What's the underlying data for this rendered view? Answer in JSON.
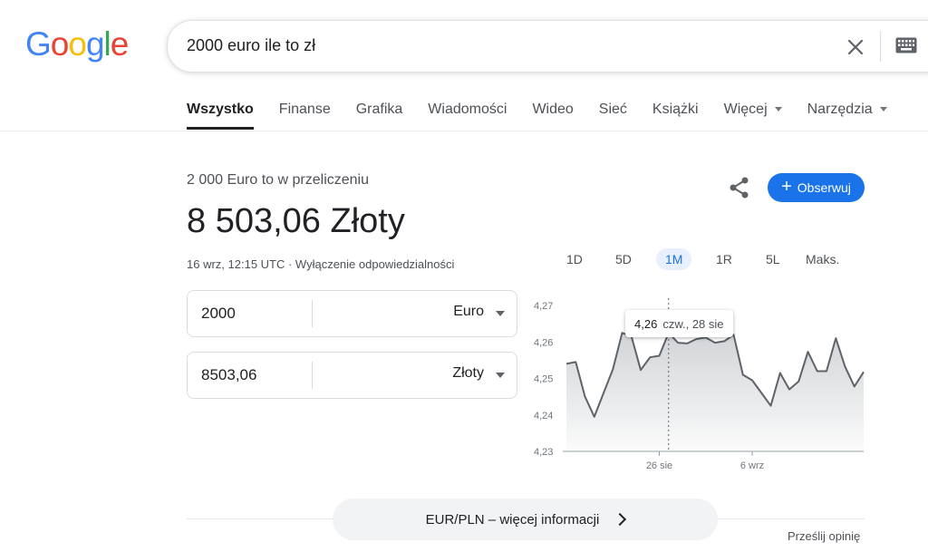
{
  "logo": {
    "letters": [
      "G",
      "o",
      "o",
      "g",
      "l",
      "e"
    ],
    "colors": [
      "#4285F4",
      "#EA4335",
      "#FBBC05",
      "#4285F4",
      "#34A853",
      "#EA4335"
    ]
  },
  "search": {
    "query": "2000 euro ile to zł"
  },
  "tabs": [
    {
      "label": "Wszystko",
      "active": true
    },
    {
      "label": "Finanse"
    },
    {
      "label": "Grafika"
    },
    {
      "label": "Wiadomości"
    },
    {
      "label": "Wideo"
    },
    {
      "label": "Sieć"
    },
    {
      "label": "Książki"
    },
    {
      "label": "Więcej",
      "dropdown": true
    },
    {
      "label": "Narzędzia",
      "dropdown": true
    }
  ],
  "result": {
    "subtitle": "2 000 Euro to w przeliczeniu",
    "amount": "8 503,06 Złoty",
    "timestamp": "16 wrz, 12:15 UTC · Wyłączenie odpowiedzialności",
    "follow_label": "Obserwuj",
    "follow_color": "#1a73e8"
  },
  "converter": {
    "from": {
      "value": "2000",
      "currency": "Euro"
    },
    "to": {
      "value": "8503,06",
      "currency": "Złoty"
    }
  },
  "ranges": [
    {
      "label": "1D"
    },
    {
      "label": "5D"
    },
    {
      "label": "1M",
      "active": true
    },
    {
      "label": "1R"
    },
    {
      "label": "5L"
    },
    {
      "label": "Maks."
    }
  ],
  "chart_data": {
    "type": "area",
    "yticks": [
      "4,27",
      "4,26",
      "4,25",
      "4,24",
      "4,23"
    ],
    "ylim": [
      4.23,
      4.27
    ],
    "xticks": [
      "26 sie",
      "6 wrz"
    ],
    "values": [
      4.254,
      4.2545,
      4.245,
      4.2395,
      4.246,
      4.2525,
      4.2625,
      4.2615,
      4.2523,
      4.2558,
      4.2562,
      4.2625,
      4.2598,
      4.2596,
      4.2608,
      4.2612,
      4.2598,
      4.2602,
      4.262,
      4.251,
      4.2495,
      4.246,
      4.2425,
      4.2515,
      4.247,
      4.2492,
      4.2573,
      4.252,
      4.252,
      4.261,
      4.2532,
      4.2478,
      4.2518
    ],
    "series_color": "#5f6368",
    "tooltip": {
      "value": "4,26",
      "date": "czw., 28 sie"
    }
  },
  "more_info": {
    "label": "EUR/PLN – więcej informacji"
  },
  "feedback": {
    "label": "Prześlij opinię"
  }
}
